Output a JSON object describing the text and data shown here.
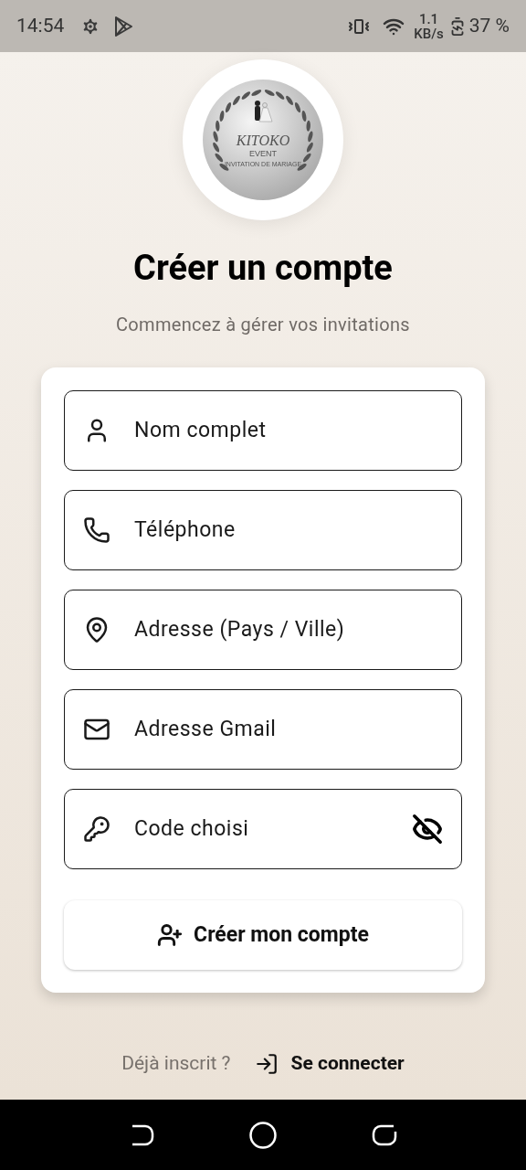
{
  "status_bar": {
    "time": "14:54",
    "speed_value": "1.1",
    "speed_unit": "KB/s",
    "battery": "37 %"
  },
  "logo": {
    "name": "KITOKO",
    "tagline": "EVENT",
    "subtitle": "INVITATION DE MARIAGE"
  },
  "title": "Créer un compte",
  "subtitle": "Commencez à gérer vos invitations",
  "fields": [
    {
      "kind": "name",
      "placeholder": "Nom complet"
    },
    {
      "kind": "phone",
      "placeholder": "Téléphone"
    },
    {
      "kind": "address",
      "placeholder": "Adresse (Pays / Ville)"
    },
    {
      "kind": "email",
      "placeholder": "Adresse Gmail"
    },
    {
      "kind": "password",
      "placeholder": "Code choisi",
      "password_visible": false
    }
  ],
  "submit_button": "Créer mon compte",
  "footer": {
    "prompt": "Déjà inscrit ?",
    "link": "Se connecter"
  }
}
